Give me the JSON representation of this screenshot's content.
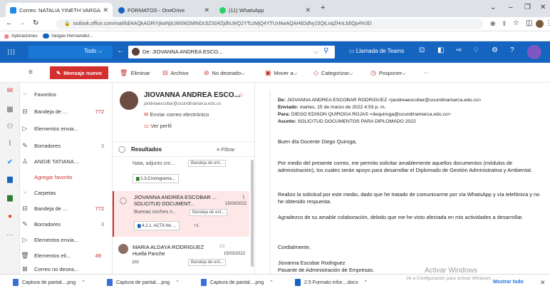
{
  "browser": {
    "tabs": [
      {
        "title": "Correo: NATALIA YINETH VARGA",
        "active": true,
        "icon_color": "#1e88e5"
      },
      {
        "title": "FORMATOS - OneDrive",
        "active": false,
        "icon_color": "#1565c0"
      },
      {
        "title": "(11) WhatsApp",
        "active": false,
        "icon_color": "#25d366"
      }
    ],
    "new_tab": "+",
    "url": "outlook.office.com/mail/id/AAQkAGRiYjkwNjILWI0M2MtNDc5ZS04ZjdhLWQ2YTczMjQ4YTUxNwAQAH6Ddhy15QtLnqZHnLb5Qp4%3D",
    "bookmarks": [
      "Aplicaciones",
      "Vargas Hernandez..."
    ]
  },
  "outlook": {
    "filter": "Todo",
    "search_value": "De: JIOVANNA ANDREA ESCO...",
    "teams_label": "Llamada de Teams"
  },
  "toolbar": {
    "new_mail": "Mensaje nuevo",
    "delete": "Eliminar",
    "archive": "Archivo",
    "junk": "No deseado",
    "move": "Mover a",
    "categorize": "Categorizar",
    "snooze": "Posponer",
    "more": "···"
  },
  "folders": {
    "favorites_label": "Favoritos",
    "items": [
      {
        "label": "Bandeja de ...",
        "count": "772",
        "icon": "inbox-icon"
      },
      {
        "label": "Elementos envia...",
        "count": "",
        "icon": "send-icon"
      },
      {
        "label": "Borradores",
        "count": "3",
        "icon": "draft-icon"
      },
      {
        "label": "ANGIE TATIANA ...",
        "count": "",
        "icon": "person-icon"
      }
    ],
    "add_favorite": "Agregar favorito",
    "folders_label": "Carpetas",
    "folder_items": [
      {
        "label": "Bandeja de ...",
        "count": "772",
        "icon": "inbox-icon"
      },
      {
        "label": "Borradores",
        "count": "3",
        "icon": "draft-icon"
      },
      {
        "label": "Elementos envia...",
        "count": "",
        "icon": "send-icon"
      },
      {
        "label": "Elementos eli...",
        "count": "49",
        "icon": "trash-icon"
      },
      {
        "label": "Correo no desea...",
        "count": "",
        "icon": "junk-icon"
      }
    ]
  },
  "contact_card": {
    "name": "JIOVANNA ANDREA ESCO...",
    "email": "jandreaescobar@ucundinamarca.edu.co",
    "send_email": "Enviar correo electrónico",
    "view_profile": "Ver perfil"
  },
  "results": {
    "label": "Resultados",
    "filter": "Filtrar",
    "items": [
      {
        "preview": "Nata, adjunto cro...",
        "tag": "Bandeja de ent...",
        "attachment": "1.3.Cronograma..."
      },
      {
        "sender": "JIOVANNA ANDREA ESCOBAR ...",
        "subject": "SOLICITUD DOCUMENT...",
        "date": "15/03/2022",
        "preview": "Buenas noches n...",
        "tag": "Bandeja de ent...",
        "attachment": "4.2.1. ACTA No ...",
        "extra": "+1"
      },
      {
        "sender": "MARIA ALDAYA RODRIGUEZ",
        "subject": "Huella Panche",
        "date": "15/03/2022",
        "preview": "psi",
        "tag": "Bandeja de ent..."
      }
    ]
  },
  "message": {
    "from_label": "De:",
    "from": "JIOVANNA ANDREA ESCOBAR RODRIGUEZ <jandreaescobar@ucundinamarca.edu.co>",
    "sent_label": "Enviado:",
    "sent": "martes, 15 de marzo de 2022 4:53 p. m.",
    "to_label": "Para:",
    "to": "DIEGO EDISON QUIROGA ROJAS <dequiroga@ucundinamarca.edu.co>",
    "subject_label": "Asunto:",
    "subject": "SOLICITUD DOCUMENTOS PARA DIPLOMADO 2022",
    "greeting": "Buen día Docente Diego Quiroga,",
    "p1": "Por medio del presente correo, me permito solicitar amablemente aquellos documentos (módulos de administración), los cuales serán apoyo para desarrollar el Diplomado de Gestión Administrativa y Ambiental.",
    "p2": "Realizo la solicitud por este medio, dado que he tratado de comunicarme por vía WhatsApp y vía telefónica y no he obtenido respuesta.",
    "p3": "Agradezco de su amable colaboración, debido que me he visto afectada en mis actividades a desarrollar.",
    "closing": "Cordialmente,",
    "sig1": "Jiovanna Escobar Rodriguez",
    "sig2": "Pasante de Administración de Empresas."
  },
  "watermark": {
    "line1": "Activar Windows",
    "line2": "Ve a Configuración para activar Windows."
  },
  "downloads": {
    "items": [
      "Captura de pantal....png",
      "Captura de pantal....png",
      "Captura de pantal....png",
      "2.5 Formato infor....docx"
    ],
    "show_all": "Mostrar todo"
  }
}
